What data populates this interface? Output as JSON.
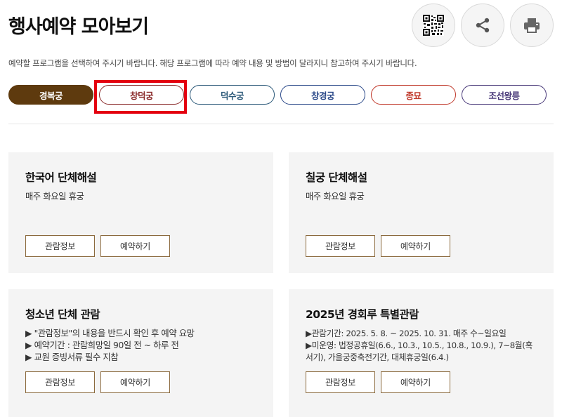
{
  "page": {
    "title": "행사예약 모아보기",
    "description": "예약할 프로그램을 선택하여 주시기 바랍니다. 해당 프로그램에 따라 예약 내용 및 방법이 달라지니 참고하여 주시기 바랍니다."
  },
  "actions": {
    "qr": "qr-code-icon",
    "share": "share-icon",
    "print": "print-icon"
  },
  "tabs": [
    {
      "label": "경복궁",
      "color": "#5e3a0e",
      "active": true
    },
    {
      "label": "창덕궁",
      "color": "#8a2a2a",
      "active": false
    },
    {
      "label": "덕수궁",
      "color": "#2d5a7a",
      "active": false
    },
    {
      "label": "창경궁",
      "color": "#2c4a8a",
      "active": false
    },
    {
      "label": "종묘",
      "color": "#c0392b",
      "active": false
    },
    {
      "label": "조선왕릉",
      "color": "#4a3a7a",
      "active": false
    }
  ],
  "highlight_color": "#e4000f",
  "cards": [
    {
      "title": "한국어 단체해설",
      "lines": [
        "매주 화요일 휴궁"
      ],
      "info_label": "관람정보",
      "reserve_label": "예약하기"
    },
    {
      "title": "칠궁 단체해설",
      "lines": [
        "매주 화요일 휴궁"
      ],
      "info_label": "관람정보",
      "reserve_label": "예약하기"
    },
    {
      "title": "청소년 단체 관람",
      "lines": [
        "▶ \"관람정보\"의 내용을 반드시 확인 후 예약 요망",
        "▶ 예약기간 : 관람희망일 90일 전 ~ 하루 전",
        "▶ 교원 증빙서류 필수 지참"
      ],
      "info_label": "관람정보",
      "reserve_label": "예약하기"
    },
    {
      "title": "2025년 경회루 특별관람",
      "lines": [
        "▶관람기간: 2025. 5. 8. ~ 2025. 10. 31. 매주 수~일요일",
        "▶미운영: 법정공휴일(6.6., 10.3., 10.5., 10.8., 10.9.), 7~8월(혹",
        "서기), 가을궁중축전기간, 대체휴궁일(6.4.)"
      ],
      "info_label": "관람정보",
      "reserve_label": "예약하기"
    }
  ]
}
